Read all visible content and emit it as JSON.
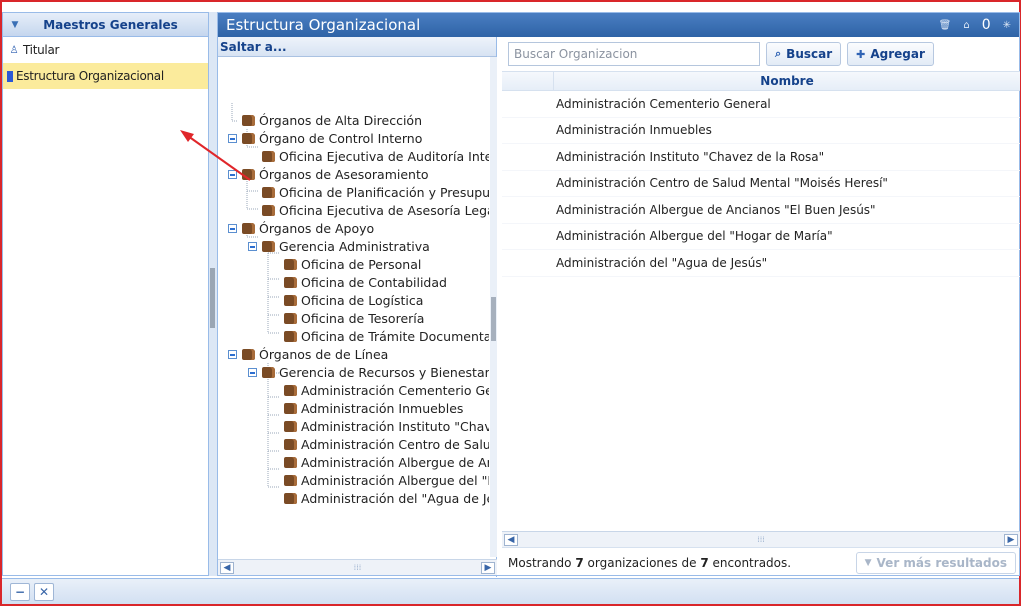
{
  "sidebar": {
    "title": "Maestros Generales",
    "items": [
      {
        "label": "Titular",
        "icon": "user-icon"
      },
      {
        "label": "Estructura Organizacional",
        "icon": "org-square-icon"
      }
    ]
  },
  "panel": {
    "title": "Estructura Organizacional",
    "count": "0"
  },
  "tree": {
    "header": "Saltar a...",
    "nodes": [
      "Órganos de Alta Dirección",
      "Órgano de Control Interno",
      "Oficina Ejecutiva de Auditoría Interna",
      "Órganos de Asesoramiento",
      "Oficina de Planificación y Presupuesto",
      "Oficina Ejecutiva de Asesoría Legal",
      "Órganos de Apoyo",
      "Gerencia Administrativa",
      "Oficina de Personal",
      "Oficina de Contabilidad",
      "Oficina de Logística",
      "Oficina de Tesorería",
      "Oficina de Trámite Documentario",
      "Órganos de de Línea",
      "Gerencia de Recursos y Bienestar",
      "Administración Cementerio General",
      "Administración Inmuebles",
      "Administración Instituto \"Chavez de la Rosa\"",
      "Administración Centro de Salud Mental \"Moisés Heresí\"",
      "Administración Albergue de Ancianos \"El Buen Jesús\"",
      "Administración Albergue del \"Hogar de María\"",
      "Administración del \"Agua de Jesús\""
    ]
  },
  "grid": {
    "search_placeholder": "Buscar Organizacion",
    "search_button": "Buscar",
    "add_button": "Agregar",
    "column_name": "Nombre",
    "rows": [
      "Administración Cementerio General",
      "Administración Inmuebles",
      "Administración Instituto \"Chavez de la Rosa\"",
      "Administración Centro de Salud Mental \"Moisés Heresí\"",
      "Administración Albergue de Ancianos \"El Buen Jesús\"",
      "Administración Albergue del \"Hogar de María\"",
      "Administración del \"Agua de Jesús\""
    ],
    "footer_prefix": "Mostrando",
    "footer_count": "7",
    "footer_middle": "organizaciones de",
    "footer_total": "7",
    "footer_suffix": "encontrados.",
    "more_button": "Ver más resultados"
  },
  "colors": {
    "accent": "#2e63a6",
    "selection": "#fbeb9c",
    "annotation": "#e0262a"
  }
}
